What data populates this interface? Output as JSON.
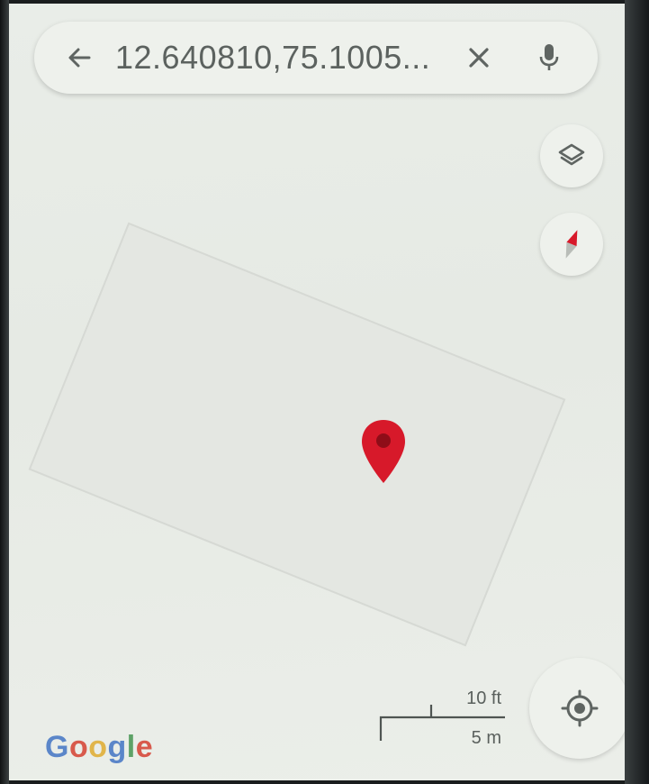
{
  "search": {
    "query": "12.640810,75.1005..."
  },
  "icons": {
    "back": "arrow-left-icon",
    "clear": "close-icon",
    "mic": "microphone-icon",
    "layers": "layers-icon",
    "compass": "compass-icon",
    "my_location": "my-location-icon",
    "pin": "map-pin-icon"
  },
  "scale": {
    "imperial": "10 ft",
    "metric": "5 m"
  },
  "logo": {
    "letters": [
      "G",
      "o",
      "o",
      "g",
      "l",
      "e"
    ],
    "colors": [
      "#5b86c9",
      "#d85a4c",
      "#e1b54a",
      "#5b86c9",
      "#5ea267",
      "#d85a4c"
    ]
  },
  "colors": {
    "pin": "#d7192a",
    "pin_dark": "#8e0d18",
    "compass_red": "#d7192a",
    "icon_gray": "#5f6562"
  }
}
